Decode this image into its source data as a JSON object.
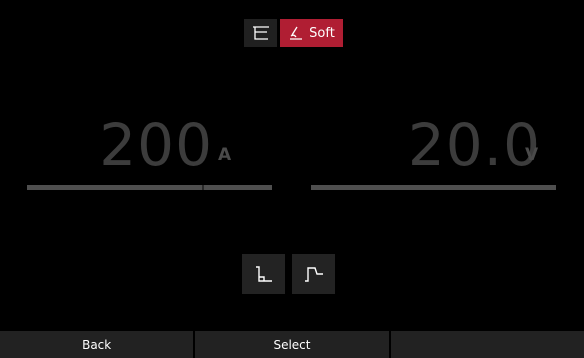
{
  "mode_selector": {
    "items": [
      {
        "icon": "stick-electrode-icon",
        "label": ""
      },
      {
        "icon": "soft-arc-icon",
        "label": "Soft",
        "active": true
      }
    ],
    "accent_color": "#b01e33"
  },
  "current": {
    "value": "200",
    "unit": "A"
  },
  "voltage": {
    "value": "20.0",
    "unit": "V"
  },
  "waveform_buttons": [
    {
      "icon": "step-down-waveform-icon"
    },
    {
      "icon": "step-up-waveform-icon"
    }
  ],
  "softkeys": {
    "back": "Back",
    "select": "Select",
    "third": ""
  }
}
